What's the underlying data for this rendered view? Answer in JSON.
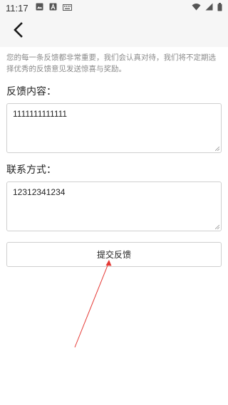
{
  "status_bar": {
    "time": "11:17",
    "left_icons": [
      "image-icon",
      "text-a-icon",
      "keyboard-icon"
    ],
    "right_icons": [
      "wifi-icon",
      "signal-icon",
      "battery-icon"
    ]
  },
  "toolbar": {
    "back_icon": "back-arrow-icon"
  },
  "notice": {
    "text": "您的每一条反馈都非常重要，我们会认真对待，我们将不定期选择优秀的反馈意见发送惊喜与奖励。"
  },
  "feedback": {
    "label": "反馈内容：",
    "value": "1111111111111"
  },
  "contact": {
    "label": "联系方式：",
    "value": "12312341234"
  },
  "submit": {
    "label": "提交反馈"
  },
  "colors": {
    "toolbar_bg": "#f6f6f6",
    "border": "#cfcfcf",
    "hint_text": "#8a8a8a",
    "annotation_arrow": "#e53935"
  }
}
